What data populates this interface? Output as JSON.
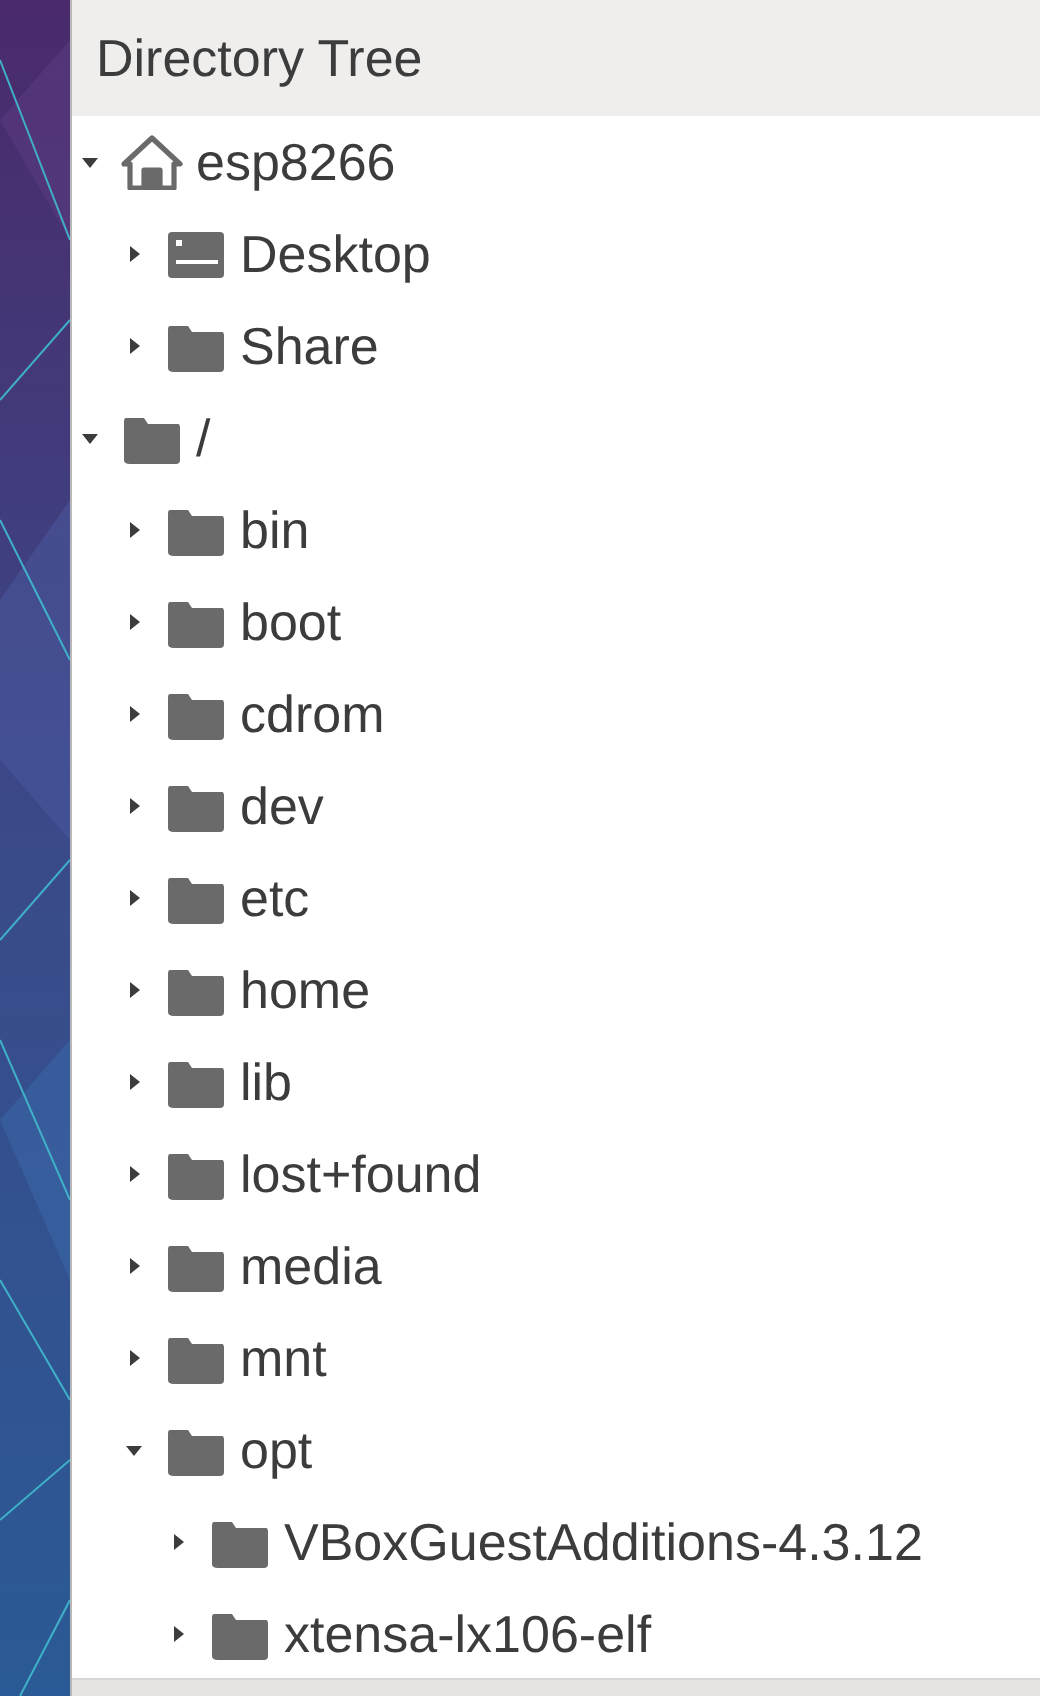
{
  "panel": {
    "title": "Directory Tree"
  },
  "tree": [
    {
      "label": "esp8266",
      "kind": "home",
      "expanded": true,
      "children": [
        {
          "label": "Desktop",
          "kind": "desktop",
          "expanded": false
        },
        {
          "label": "Share",
          "kind": "folder",
          "expanded": false
        }
      ]
    },
    {
      "label": "/",
      "kind": "folder",
      "expanded": true,
      "children": [
        {
          "label": "bin",
          "kind": "folder",
          "expanded": false
        },
        {
          "label": "boot",
          "kind": "folder",
          "expanded": false
        },
        {
          "label": "cdrom",
          "kind": "folder",
          "expanded": false
        },
        {
          "label": "dev",
          "kind": "folder",
          "expanded": false
        },
        {
          "label": "etc",
          "kind": "folder",
          "expanded": false
        },
        {
          "label": "home",
          "kind": "folder",
          "expanded": false
        },
        {
          "label": "lib",
          "kind": "folder",
          "expanded": false
        },
        {
          "label": "lost+found",
          "kind": "folder",
          "expanded": false
        },
        {
          "label": "media",
          "kind": "folder",
          "expanded": false
        },
        {
          "label": "mnt",
          "kind": "folder",
          "expanded": false
        },
        {
          "label": "opt",
          "kind": "folder",
          "expanded": true,
          "children": [
            {
              "label": "VBoxGuestAdditions-4.3.12",
              "kind": "folder",
              "expanded": false
            },
            {
              "label": "xtensa-lx106-elf",
              "kind": "folder",
              "expanded": false
            }
          ]
        }
      ]
    }
  ]
}
